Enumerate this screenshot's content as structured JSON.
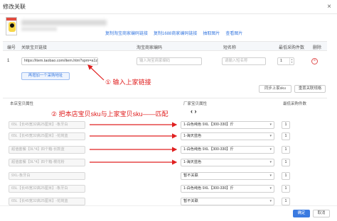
{
  "dialog": {
    "title": "修改关联",
    "close_glyph": "×"
  },
  "links": [
    "复制淘宝商家编码链接",
    "复制1688商家编码链接",
    "抽取图片",
    "查看图片"
  ],
  "table": {
    "headers": {
      "idx": "编号",
      "link": "关联宝贝链接",
      "taobao": "淘宝商家编码",
      "short": "短名称",
      "min_buy": "最低采购件数",
      "delete": "删除"
    },
    "row": {
      "idx": "1",
      "link_value": "https://item.taobao.com/item.htm?spm=a1z09.2.0.0.c",
      "taobao_placeholder": "输入淘宝商家编码",
      "short_placeholder": "请输入短名称",
      "qty": "1",
      "delete_glyph": "×"
    }
  },
  "buttons": {
    "add_row": "再增加一个采购地址",
    "sync_sku": "同步上家sku",
    "reset_link": "重置关联规格",
    "confirm": "确定",
    "cancel": "取消"
  },
  "annotations": {
    "step1": "① 输入上家链接",
    "step2": "② 把本店宝贝sku与上家宝贝sku——匹配",
    "nav": "‹  ›"
  },
  "mapping": {
    "headers": {
      "local": "本店宝贝属性",
      "supplier": "厂家宝贝属性",
      "min": "最低采购件数"
    },
    "rows": [
      {
        "local": "65L【长45宽32高25厘米】-象牙白",
        "supplier": "1-白色纯色 9XL【300-330】斤",
        "qty": "1"
      },
      {
        "local": "65L【长45宽32高25厘米】-花岗蓝",
        "supplier": "1-海天蓝色",
        "qty": "1"
      },
      {
        "local": "超值套餐【9L*4】四个箱-长款蓝",
        "supplier": "1-白色纯色 9XL【300-330】斤",
        "qty": "1"
      },
      {
        "local": "超值套餐【9L*4】四个箱-樱花粉",
        "supplier": "1-海天蓝色",
        "qty": "1"
      },
      {
        "local": "9XL-象牙白",
        "supplier": "暂不关联",
        "qty": "1"
      },
      {
        "local": "65L【长45宽32高25厘米】-象牙白",
        "supplier": "1-白色纯色 9XL【300-330】斤",
        "qty": "1"
      },
      {
        "local": "65L【长45宽32高25厘米】-花岗蓝",
        "supplier": "暂不关联",
        "qty": "1"
      }
    ]
  },
  "colors": {
    "accent": "#3a7ae0",
    "annotation": "#e02020"
  }
}
